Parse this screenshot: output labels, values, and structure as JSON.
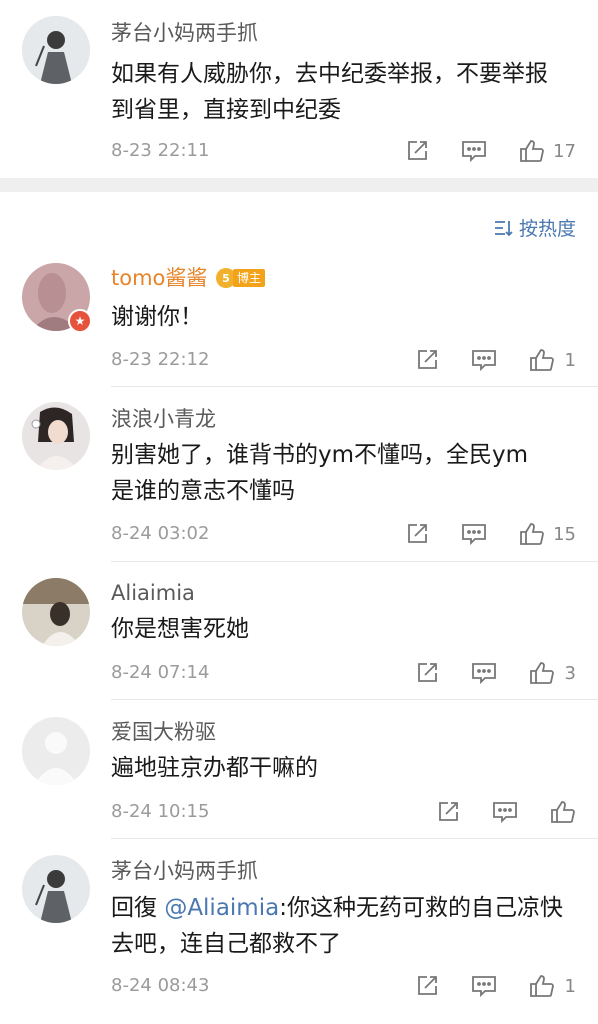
{
  "comments_top": [
    {
      "username": "茅台小妈两手抓",
      "text_line1": "如果有人威胁你，去中纪委举报，不要举报",
      "text_line2": "到省里，直接到中纪委",
      "time": "8-23 22:11",
      "likes": "17"
    }
  ],
  "sort": {
    "label": "按热度",
    "icon": "sort-icon"
  },
  "comments": [
    {
      "username": "tomo酱酱",
      "badge": "博主",
      "badge_num": "5",
      "text_line1": "谢谢你！",
      "text_line2": "",
      "time": "8-23 22:12",
      "likes": "1"
    },
    {
      "username": "浪浪小青龙",
      "text_line1": "别害她了，谁背书的ym不懂吗，全民ym",
      "text_line2": "是谁的意志不懂吗",
      "time": "8-24 03:02",
      "likes": "15"
    },
    {
      "username": "Aliaimia",
      "text_line1": "你是想害死她",
      "text_line2": "",
      "time": "8-24 07:14",
      "likes": "3"
    },
    {
      "username": "爱国大粉驱",
      "text_line1": "遍地驻京办都干嘛的",
      "text_line2": "",
      "time": "8-24 10:15",
      "likes": ""
    },
    {
      "username": "茅台小妈两手抓",
      "reply_prefix": "回復 ",
      "mention": "@Aliaimia",
      "text_line1_rest": ":你这种无药可救的自己凉快",
      "text_line2": "去吧，连自己都救不了",
      "time": "8-24 08:43",
      "likes": "1"
    }
  ],
  "colors": {
    "accent": "#4a78b0",
    "vip_name": "#e8842a",
    "meta": "#9b9b9b",
    "divider": "#e7e7e7"
  }
}
